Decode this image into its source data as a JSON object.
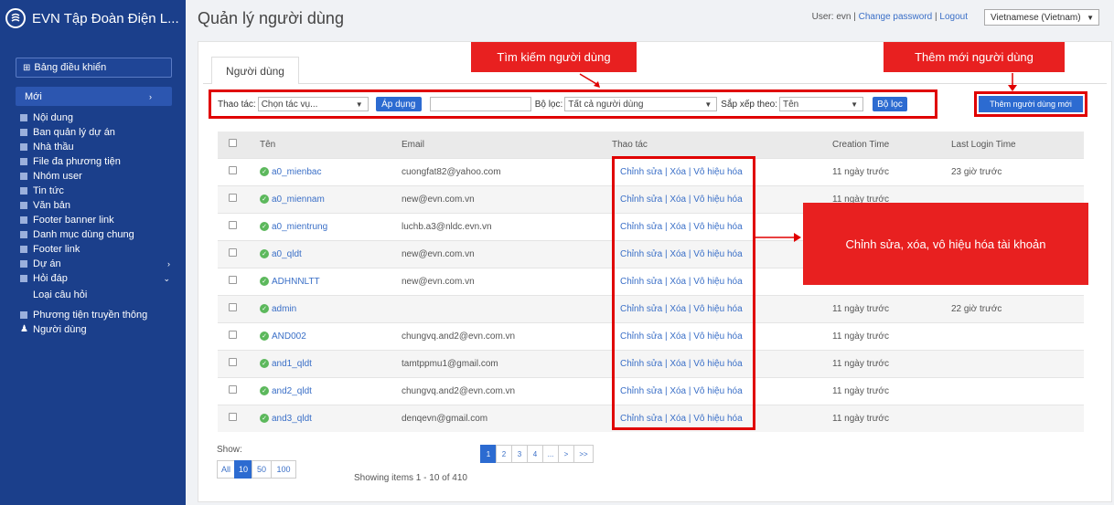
{
  "app": {
    "title": "EVN Tập Đoàn Điện L..."
  },
  "sidebar": {
    "dashboard": "Bảng điều khiển",
    "new": "Mới",
    "items": [
      {
        "label": "Nội dung"
      },
      {
        "label": "Ban quản lý dự án"
      },
      {
        "label": "Nhà thầu"
      },
      {
        "label": "File đa phương tiện"
      },
      {
        "label": "Nhóm user"
      },
      {
        "label": "Tin tức"
      },
      {
        "label": "Văn bản"
      },
      {
        "label": "Footer banner link"
      },
      {
        "label": "Danh mục dùng chung"
      },
      {
        "label": "Footer link"
      },
      {
        "label": "Dự án"
      },
      {
        "label": "Hỏi đáp"
      }
    ],
    "subitem": "Loại câu hỏi",
    "media": "Phương tiện truyền thông",
    "users": "Người dùng"
  },
  "header": {
    "page_title": "Quản lý người dùng",
    "user_prefix": "User: evn",
    "change_password": "Change password",
    "logout": "Logout",
    "separator": "|",
    "language": "Vietnamese (Vietnam)"
  },
  "tab": {
    "label": "Người dùng"
  },
  "toolbar": {
    "action_label": "Thao tác:",
    "action_value": "Chọn tác vụ...",
    "apply": "Áp dụng",
    "search_value": "",
    "filter_label": "Bộ lọc:",
    "filter_value": "Tất cả người dùng",
    "sort_label": "Sắp xếp theo:",
    "sort_value": "Tên",
    "filter_button": "Bộ lọc",
    "add_user": "Thêm người dùng mới"
  },
  "callouts": {
    "search": "Tìm kiếm người dùng",
    "add": "Thêm mới người dùng",
    "actions": "Chỉnh sửa, xóa, vô hiệu hóa tài khoản"
  },
  "table": {
    "headers": [
      "Tên",
      "Email",
      "Thao tác",
      "Creation Time",
      "Last Login Time"
    ],
    "action_text": "Chỉnh sửa | Xóa | Vô hiệu hóa",
    "rows": [
      {
        "name": "a0_mienbac",
        "email": "cuongfat82@yahoo.com",
        "created": "11 ngày trước",
        "last_login": "23 giờ trước"
      },
      {
        "name": "a0_miennam",
        "email": "new@evn.com.vn",
        "created": "11 ngày trước",
        "last_login": ""
      },
      {
        "name": "a0_mientrung",
        "email": "luchb.a3@nldc.evn.vn",
        "created": "",
        "last_login": ""
      },
      {
        "name": "a0_qldt",
        "email": "new@evn.com.vn",
        "created": "",
        "last_login": ""
      },
      {
        "name": "ADHNNLTT",
        "email": "new@evn.com.vn",
        "created": "",
        "last_login": ""
      },
      {
        "name": "admin",
        "email": "",
        "created": "11 ngày trước",
        "last_login": "22 giờ trước"
      },
      {
        "name": "AND002",
        "email": "chungvq.and2@evn.com.vn",
        "created": "11 ngày trước",
        "last_login": ""
      },
      {
        "name": "and1_qldt",
        "email": "tamtppmu1@gmail.com",
        "created": "11 ngày trước",
        "last_login": ""
      },
      {
        "name": "and2_qldt",
        "email": "chungvq.and2@evn.com.vn",
        "created": "11 ngày trước",
        "last_login": ""
      },
      {
        "name": "and3_qldt",
        "email": "denqevn@gmail.com",
        "created": "11 ngày trước",
        "last_login": ""
      }
    ]
  },
  "footer": {
    "show_label": "Show:",
    "page_sizes": [
      "All",
      "10",
      "50",
      "100"
    ],
    "showing": "Showing items 1 - 10 of 410",
    "pages": [
      "1",
      "2",
      "3",
      "4",
      "...",
      ">",
      ">>"
    ]
  },
  "colors": {
    "sidebar": "#1b3f8b",
    "accent": "#2c6bd1",
    "callout": "#e82020"
  }
}
